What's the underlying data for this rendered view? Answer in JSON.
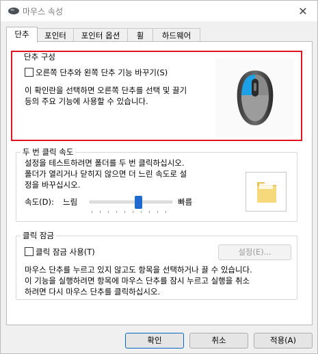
{
  "window": {
    "title": "마우스 속성"
  },
  "tabs": [
    {
      "label": "단추"
    },
    {
      "label": "포인터"
    },
    {
      "label": "포인터 옵션"
    },
    {
      "label": "휠"
    },
    {
      "label": "하드웨어"
    }
  ],
  "button_config": {
    "group_label": "단추 구성",
    "checkbox_label": "오른쪽 단추와 왼쪽 단추 기능 바꾸기(S)",
    "checked": false,
    "description_line1": "이 확인란을 선택하면 오른쪽 단추를 선택 및 끌기",
    "description_line2": "등의 주요 기능에 사용할 수 있습니다."
  },
  "double_click": {
    "group_label": "두 번 클릭 속도",
    "description_line1": "설정을 테스트하려면 폴더를 두 번 클릭하십시오.",
    "description_line2": "폴더가 열리거나 닫히지 않으면 더 느린 속도로 설",
    "description_line3": "정을 바꾸십시오.",
    "speed_label": "속도(D):",
    "slow_label": "느림",
    "fast_label": "빠름",
    "speed_value": 0.6
  },
  "click_lock": {
    "group_label": "클릭 잠금",
    "checkbox_label": "클릭 잠금 사용(T)",
    "checked": false,
    "settings_button": "설정(E)...",
    "description_line1": "마우스 단추를 누르고 있지 않고도 항목을 선택하거나 끌 수 있습니다.",
    "description_line2": "이 기능을 실행하려면 항목에 마우스 단추를 잠시 누르고 실행을 취소",
    "description_line3": "하려면 다시 마우스 단추를 클릭하십시오."
  },
  "footer": {
    "ok": "확인",
    "cancel": "취소",
    "apply": "적용(A)"
  },
  "colors": {
    "highlight": "#e0141e",
    "slider_thumb": "#1f6ad1",
    "mouse_accent": "#1ea0e6"
  }
}
